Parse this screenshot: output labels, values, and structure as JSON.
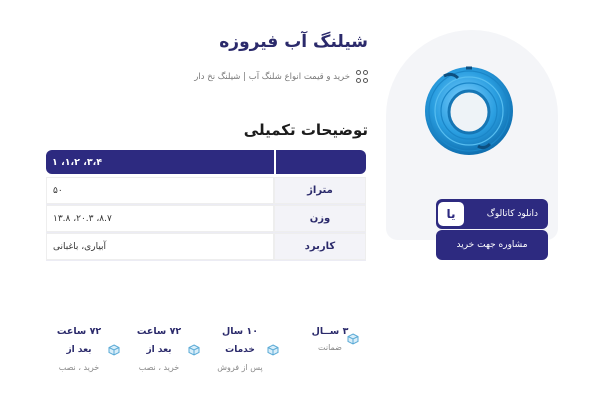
{
  "product": {
    "title": "شیلنگ آب فیروزه",
    "subtitle": "خرید و قیمت انواع شلنگ آب | شیلنگ نخ دار"
  },
  "specs": {
    "section_title": "توضیحات تکمیلی",
    "header_value": "۳،۴، ۱،۲، ۱",
    "rows": [
      {
        "key": "متراژ",
        "value": "۵۰"
      },
      {
        "key": "وزن",
        "value": "۸.۷، ۲۰.۳، ۱۳.۸"
      },
      {
        "key": "کاربرد",
        "value": "آبیاری، باغبانی"
      }
    ]
  },
  "actions": {
    "catalog_label": "دانلود کاتالوگ",
    "catalog_badge": "یا",
    "consult_label": "مشاوره جهت خرید"
  },
  "features": [
    {
      "line1": "۳ ســال",
      "line2": "",
      "line3": "ضمانت"
    },
    {
      "line1": "۱۰ سال",
      "line2": "خدمات",
      "line3": "پس از فروش"
    },
    {
      "line1": "۷۲ ساعت",
      "line2": "بعد از",
      "line3": "خرید ، نصب"
    },
    {
      "line1": "۷۲ ساعت",
      "line2": "بعد از",
      "line3": "خرید ، نصب"
    }
  ],
  "colors": {
    "brand": "#2d2a80",
    "pipe": "#2a9ee0",
    "panel": "#f4f5f8"
  },
  "icons": [
    "grid-icon",
    "box-icon",
    "hose-coil-image"
  ]
}
